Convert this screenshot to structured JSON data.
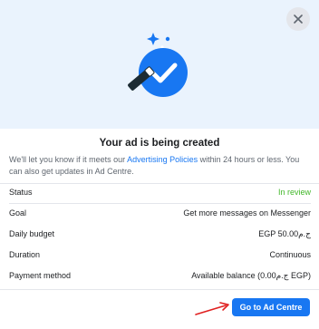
{
  "dialog": {
    "title": "Your ad is being created",
    "description_before": "We'll let you know if it meets our ",
    "description_link": "Advertising Policies",
    "description_after": " within 24 hours or less. You can also get updates in Ad Centre.",
    "close_icon": "close-icon",
    "hero_icon": "magic-wand-check-icon"
  },
  "details": [
    {
      "label": "Status",
      "value": "In review",
      "status": true
    },
    {
      "label": "Goal",
      "value": "Get more messages on Messenger"
    },
    {
      "label": "Daily budget",
      "value": "EGP 50.00ج.م"
    },
    {
      "label": "Duration",
      "value": "Continuous"
    },
    {
      "label": "Payment method",
      "value": "Available balance (0.00ج.م EGP)"
    }
  ],
  "actions": {
    "primary_label": "Go to Ad Centre"
  },
  "colors": {
    "accent": "#1877f2",
    "status_ok": "#42b72a",
    "annotation_arrow": "#e02020"
  }
}
